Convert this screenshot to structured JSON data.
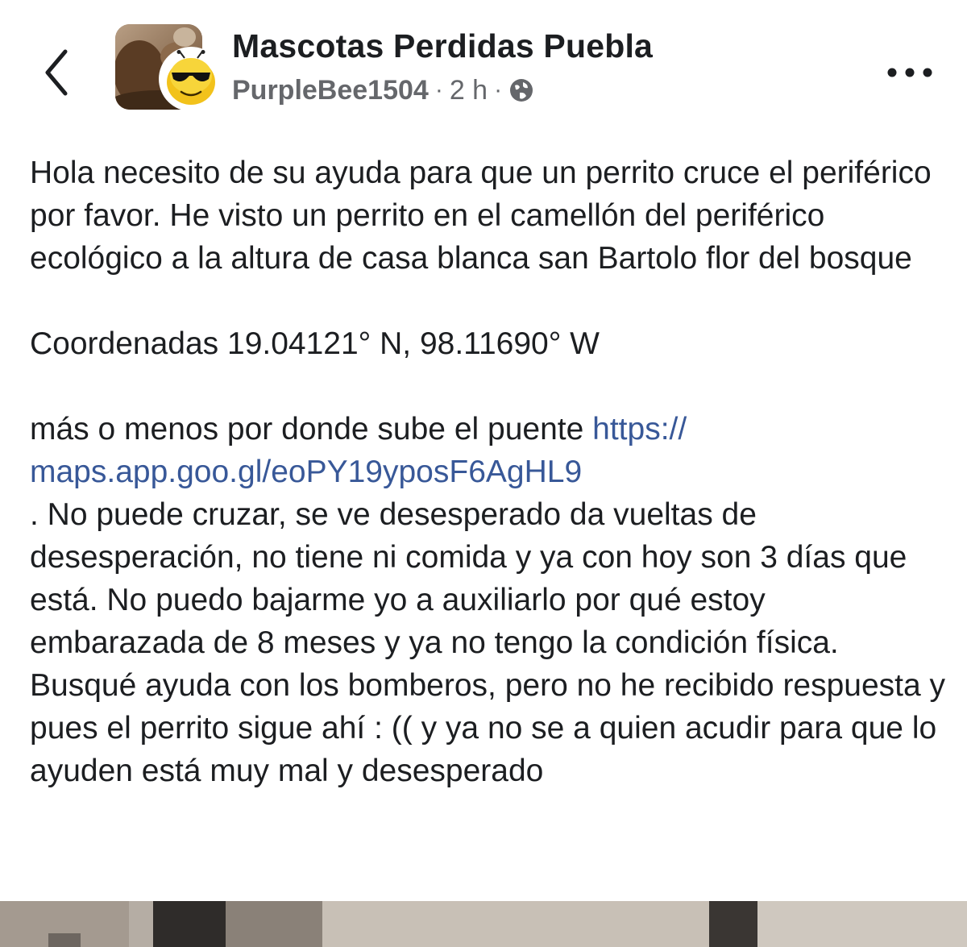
{
  "header": {
    "back_icon": "chevron-left-icon",
    "group_name": "Mascotas Perdidas Puebla",
    "author": "PurpleBee1504",
    "separator": "·",
    "time": "2 h",
    "privacy_icon": "globe-icon",
    "more_icon": "ellipsis-icon"
  },
  "post": {
    "paragraph1": "Hola necesito de su ayuda para que un perrito cruce el periférico por favor. He visto un perrito en el camellón del periférico ecológico a la altura de casa blanca san Bartolo flor del bosque",
    "paragraph2": "Coordenadas 19.04121° N, 98.11690° W",
    "paragraph3_prefix": "más o menos por donde sube el puente ",
    "link_line1": "https://",
    "link_line2": "maps.app.goo.gl/eoPY19yposF6AgHL9",
    "paragraph3_suffix": ". No puede cruzar, se ve desesperado da vueltas de desesperación, no tiene ni comida y ya con hoy son 3 días que está. No puedo bajarme yo a auxiliarlo por qué estoy embarazada de 8 meses y ya no tengo la condición física. Busqué ayuda con los bomberos, pero no he recibido respuesta y pues el perrito sigue ahí : (( y ya no se a quien acudir para que lo ayuden está muy mal y desesperado"
  },
  "colors": {
    "text": "#1c1e21",
    "secondary": "#65676b",
    "link": "#385898",
    "background": "#ffffff"
  }
}
